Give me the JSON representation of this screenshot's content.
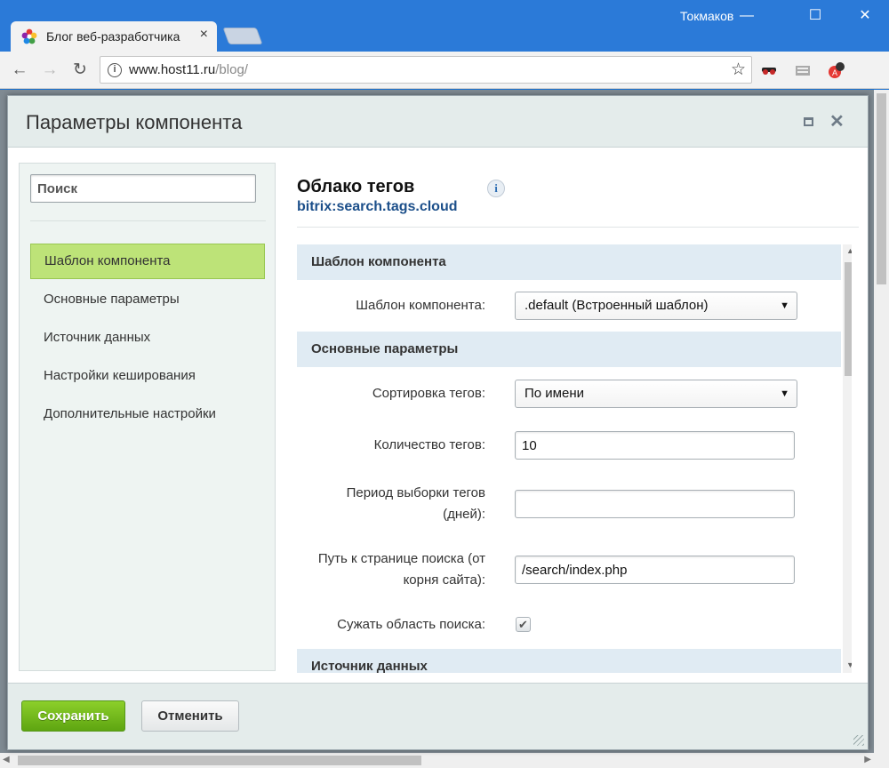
{
  "browser": {
    "tab_title": "Блог веб-разработчика",
    "tab_close": "×",
    "user_name": "Токмаков",
    "minimize": "—",
    "maximize": "☐",
    "close": "✕",
    "url_host": "www.host11.ru",
    "url_path": "/blog/",
    "back_icon": "←",
    "forward_icon": "→",
    "reload_icon": "↻",
    "star_icon": "☆",
    "info_icon": "i"
  },
  "dialog": {
    "title": "Параметры компонента",
    "close_icon": "✕",
    "component_title": "Облако тегов",
    "component_id": "bitrix:search.tags.cloud",
    "info_icon": "i",
    "search_placeholder": "Поиск",
    "sidebar": [
      {
        "label": "Шаблон компонента",
        "active": true
      },
      {
        "label": "Основные параметры",
        "active": false
      },
      {
        "label": "Источник данных",
        "active": false
      },
      {
        "label": "Настройки кеширования",
        "active": false
      },
      {
        "label": "Дополнительные настройки",
        "active": false
      }
    ],
    "sections": {
      "template": "Шаблон компонента",
      "basic": "Основные параметры",
      "source": "Источник данных"
    },
    "params": {
      "template_label": "Шаблон компонента:",
      "template_value": ".default (Встроенный шаблон)",
      "sort_label": "Сортировка тегов:",
      "sort_value": "По имени",
      "count_label": "Количество тегов:",
      "count_value": "10",
      "period_label_1": "Период выборки тегов",
      "period_label_2": "(дней):",
      "period_value": "",
      "path_label_1": "Путь к странице поиска (от",
      "path_label_2": "корня сайта):",
      "path_value": "/search/index.php",
      "narrow_label": "Сужать область поиска:",
      "narrow_checked": true
    },
    "caret": "▼",
    "check": "✔",
    "save": "Сохранить",
    "cancel": "Отменить"
  },
  "colors": {
    "titlebar": "#2b7ad8",
    "active_item": "#bde378",
    "section_head": "#e0ebf3",
    "save_button": "#6cb51a",
    "component_id": "#1c4f8a"
  }
}
